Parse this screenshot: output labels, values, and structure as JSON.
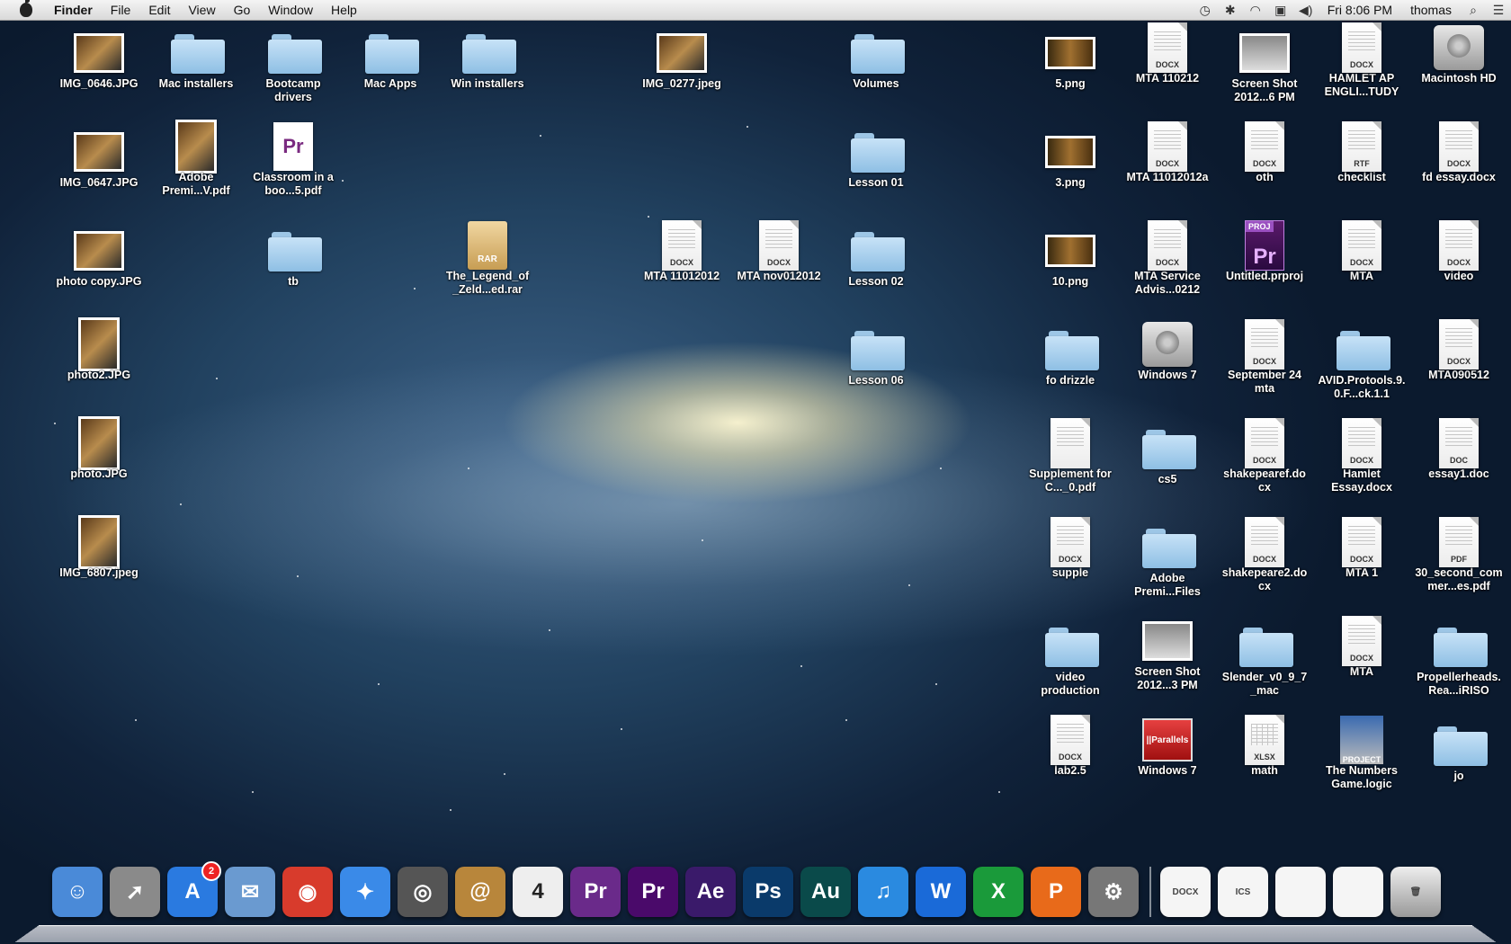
{
  "menubar": {
    "app_name": "Finder",
    "menus": [
      "File",
      "Edit",
      "View",
      "Go",
      "Window",
      "Help"
    ],
    "clock": "Fri 8:06 PM",
    "user": "thomas"
  },
  "desktop": {
    "icons": [
      {
        "label": "IMG_0646.JPG",
        "kind": "photo"
      },
      {
        "label": "Mac installers",
        "kind": "folder"
      },
      {
        "label": "Bootcamp drivers",
        "kind": "folder"
      },
      {
        "label": "Mac Apps",
        "kind": "folder"
      },
      {
        "label": "Win installers",
        "kind": "folder"
      },
      {
        "label": "IMG_0277.jpeg",
        "kind": "photo"
      },
      {
        "label": "Volumes",
        "kind": "folder"
      },
      {
        "label": "5.png",
        "kind": "game"
      },
      {
        "label": "MTA 110212",
        "kind": "doc",
        "ext": "DOCX"
      },
      {
        "label": "Screen Shot 2012...6 PM",
        "kind": "shot"
      },
      {
        "label": "HAMLET AP ENGLI...TUDY",
        "kind": "doc",
        "ext": "DOCX"
      },
      {
        "label": "Macintosh HD",
        "kind": "drive"
      },
      {
        "label": "IMG_0647.JPG",
        "kind": "photo"
      },
      {
        "label": "Adobe Premi...V.pdf",
        "kind": "tall"
      },
      {
        "label": "Classroom in a boo...5.pdf",
        "kind": "prdoc"
      },
      {
        "label": "Lesson 01",
        "kind": "folder"
      },
      {
        "label": "3.png",
        "kind": "game"
      },
      {
        "label": "MTA 11012012a",
        "kind": "doc",
        "ext": "DOCX"
      },
      {
        "label": "oth",
        "kind": "doc",
        "ext": "DOCX"
      },
      {
        "label": "checklist",
        "kind": "doc",
        "ext": "RTF"
      },
      {
        "label": "fd essay.docx",
        "kind": "doc",
        "ext": "DOCX"
      },
      {
        "label": "photo copy.JPG",
        "kind": "photo"
      },
      {
        "label": "tb",
        "kind": "folder"
      },
      {
        "label": "The_Legend_of_Zeld...ed.rar",
        "kind": "rar"
      },
      {
        "label": "MTA 11012012",
        "kind": "doc",
        "ext": "DOCX"
      },
      {
        "label": "MTA nov012012",
        "kind": "doc",
        "ext": "DOCX"
      },
      {
        "label": "Lesson 02",
        "kind": "folder"
      },
      {
        "label": "10.png",
        "kind": "game"
      },
      {
        "label": "MTA Service Advis...0212",
        "kind": "doc",
        "ext": "DOCX"
      },
      {
        "label": "Untitled.prproj",
        "kind": "prproj"
      },
      {
        "label": "MTA",
        "kind": "doc",
        "ext": "DOCX"
      },
      {
        "label": "video",
        "kind": "doc",
        "ext": "DOCX"
      },
      {
        "label": "photo2.JPG",
        "kind": "tall"
      },
      {
        "label": "Lesson 06",
        "kind": "folder"
      },
      {
        "label": "fo drizzle",
        "kind": "folder"
      },
      {
        "label": "Windows 7",
        "kind": "drive"
      },
      {
        "label": "September 24 mta",
        "kind": "doc",
        "ext": "DOCX"
      },
      {
        "label": "AVID.Protools.9.0.F...ck.1.1",
        "kind": "folder"
      },
      {
        "label": "MTA090512",
        "kind": "doc",
        "ext": "DOCX"
      },
      {
        "label": "photo.JPG",
        "kind": "tall"
      },
      {
        "label": "Supplement for C..._0.pdf",
        "kind": "doc",
        "ext": ""
      },
      {
        "label": "cs5",
        "kind": "folder"
      },
      {
        "label": "shakepearef.docx",
        "kind": "doc",
        "ext": "DOCX"
      },
      {
        "label": "Hamlet Essay.docx",
        "kind": "doc",
        "ext": "DOCX"
      },
      {
        "label": "essay1.doc",
        "kind": "doc",
        "ext": "DOC"
      },
      {
        "label": "IMG_6807.jpeg",
        "kind": "tall"
      },
      {
        "label": "supple",
        "kind": "doc",
        "ext": "DOCX"
      },
      {
        "label": "Adobe Premi...Files",
        "kind": "folder"
      },
      {
        "label": "shakepeare2.docx",
        "kind": "doc",
        "ext": "DOCX"
      },
      {
        "label": "MTA 1",
        "kind": "doc",
        "ext": "DOCX"
      },
      {
        "label": "30_second_commer...es.pdf",
        "kind": "doc",
        "ext": "PDF"
      },
      {
        "label": "video production",
        "kind": "folder"
      },
      {
        "label": "Screen Shot 2012...3 PM",
        "kind": "shot"
      },
      {
        "label": "Slender_v0_9_7_mac",
        "kind": "folder"
      },
      {
        "label": "MTA",
        "kind": "doc",
        "ext": "DOCX"
      },
      {
        "label": "Propellerheads.Rea...iRISO",
        "kind": "folder"
      },
      {
        "label": "lab2.5",
        "kind": "doc",
        "ext": "DOCX"
      },
      {
        "label": "Windows 7",
        "kind": "parallels",
        "badge": "||Parallels"
      },
      {
        "label": "math",
        "kind": "doc",
        "ext": "XLSX"
      },
      {
        "label": "The Numbers Game.logic",
        "kind": "logic",
        "badge": "PROJECT"
      },
      {
        "label": "jo",
        "kind": "folder"
      }
    ]
  },
  "dock": {
    "apps": [
      {
        "name": "finder-icon",
        "color": "#4a8ad8",
        "glyph": "☺"
      },
      {
        "name": "launchpad-icon",
        "color": "#8a8a8a",
        "glyph": "➚"
      },
      {
        "name": "app-store-icon",
        "color": "#2a7ae0",
        "glyph": "A",
        "badge": "2"
      },
      {
        "name": "mail-icon",
        "color": "#6a9ad0",
        "glyph": "✉"
      },
      {
        "name": "chrome-icon",
        "color": "#d83b2c",
        "glyph": "◉"
      },
      {
        "name": "safari-icon",
        "color": "#3a8ae8",
        "glyph": "✦"
      },
      {
        "name": "facetime-icon",
        "color": "#555",
        "glyph": "◎"
      },
      {
        "name": "address-book-icon",
        "color": "#b8863b",
        "glyph": "@"
      },
      {
        "name": "calendar-icon",
        "color": "#eee",
        "glyph": "4"
      },
      {
        "name": "premiere-icon",
        "color": "#6a2a8a",
        "glyph": "Pr"
      },
      {
        "name": "premiere-cs6-icon",
        "color": "#4a0a6a",
        "glyph": "Pr"
      },
      {
        "name": "after-effects-icon",
        "color": "#3a1a6a",
        "glyph": "Ae"
      },
      {
        "name": "photoshop-icon",
        "color": "#0a3a6a",
        "glyph": "Ps"
      },
      {
        "name": "audition-icon",
        "color": "#0a4a4a",
        "glyph": "Au"
      },
      {
        "name": "itunes-icon",
        "color": "#2a8ae0",
        "glyph": "♫"
      },
      {
        "name": "word-icon",
        "color": "#1a6ad8",
        "glyph": "W"
      },
      {
        "name": "excel-icon",
        "color": "#1a9a3a",
        "glyph": "X"
      },
      {
        "name": "powerpoint-icon",
        "color": "#e86a1a",
        "glyph": "P"
      },
      {
        "name": "system-preferences-icon",
        "color": "#777",
        "glyph": "⚙"
      }
    ],
    "docs": [
      {
        "name": "docx-stack-icon",
        "ext": "DOCX"
      },
      {
        "name": "ics-stack-icon",
        "ext": "ICS"
      },
      {
        "name": "word-doc-stack-icon",
        "ext": ""
      },
      {
        "name": "chrome-doc-stack-icon",
        "ext": ""
      },
      {
        "name": "trash-icon",
        "ext": ""
      }
    ]
  }
}
